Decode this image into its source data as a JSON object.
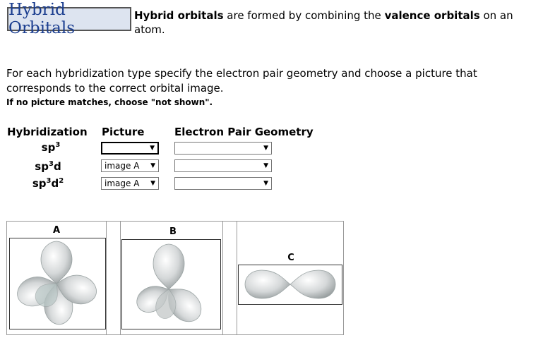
{
  "title": "Hybrid Orbitals",
  "intro": {
    "term1": "Hybrid orbitals",
    "text1": " are formed by combining the ",
    "term2": "valence orbitals",
    "text2": " on an atom."
  },
  "instructions": "For each hybridization type specify the electron pair geometry and choose a picture that corresponds to the correct orbital image.",
  "note": "If no picture matches, choose \"not shown\".",
  "headers": {
    "hybridization": "Hybridization",
    "picture": "Picture",
    "geometry": "Electron Pair Geometry"
  },
  "rows": [
    {
      "base": "sp",
      "exp": "3",
      "tail": "",
      "tail_exp": "",
      "picture": "",
      "geometry": ""
    },
    {
      "base": "sp",
      "exp": "3",
      "tail": "d",
      "tail_exp": "",
      "picture": "image A",
      "geometry": ""
    },
    {
      "base": "sp",
      "exp": "3",
      "tail": "d",
      "tail_exp": "2",
      "picture": "image A",
      "geometry": ""
    }
  ],
  "images": {
    "a_label": "A",
    "b_label": "B",
    "c_label": "C"
  },
  "colors": {
    "title_bg": "#dde4f0",
    "title_text": "#1a3d8f",
    "orbital_fill": "#cfd3d4"
  }
}
